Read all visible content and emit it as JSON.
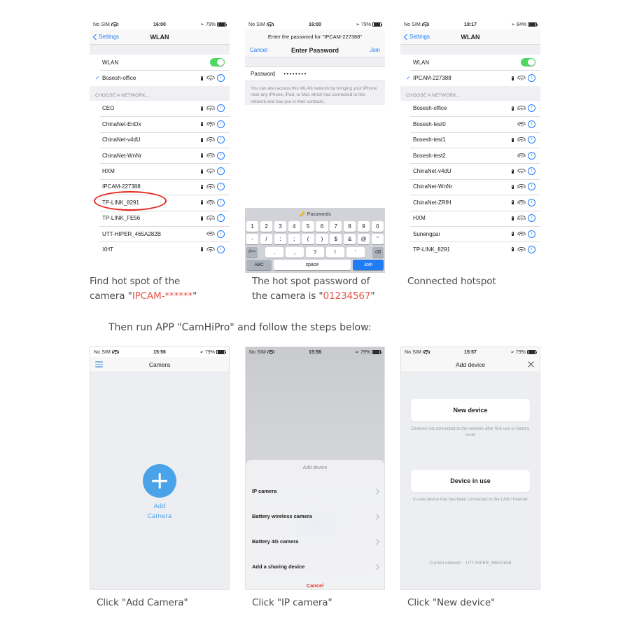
{
  "doc": {
    "middle_instruction": "Then run APP \"CamHiPro\" and follow the steps below:"
  },
  "panel1": {
    "status": {
      "carrier": "No SIM",
      "time": "16:00",
      "battery": "79%"
    },
    "nav": {
      "back": "Settings",
      "title": "WLAN"
    },
    "wlan_row_label": "WLAN",
    "connected": {
      "ssid": "Bosesh-office",
      "locked": true
    },
    "section_header": "CHOOSE A NETWORK...",
    "networks": [
      {
        "ssid": "CEO",
        "locked": true
      },
      {
        "ssid": "ChinaNet-EnDx",
        "locked": true
      },
      {
        "ssid": "ChinaNet-v4dU",
        "locked": true
      },
      {
        "ssid": "ChinaNet-WnNr",
        "locked": true
      },
      {
        "ssid": "HXM",
        "locked": true
      },
      {
        "ssid": "IPCAM-227388",
        "locked": true
      },
      {
        "ssid": "TP-LINK_8291",
        "locked": true
      },
      {
        "ssid": "TP-LINK_FE56",
        "locked": true
      },
      {
        "ssid": "UTT-HIPER_465A282B",
        "locked": false
      },
      {
        "ssid": "XHT",
        "locked": true
      }
    ],
    "caption_a": "Find hot spot of the",
    "caption_b": "camera \"",
    "caption_hl": "IPCAM-******",
    "caption_c": "\""
  },
  "panel2": {
    "status": {
      "carrier": "No SIM",
      "time": "16:00",
      "battery": "79%"
    },
    "prompt": "Enter the password for \"IPCAM-227388\"",
    "bar": {
      "cancel": "Cancel",
      "title": "Enter Password",
      "join": "Join"
    },
    "field": {
      "label": "Password",
      "value": "••••••••"
    },
    "note": "You can also access this WLAN network by bringing your iPhone near any iPhone, iPad, or Mac which has connected to this network and has you in their contacts.",
    "keyboard": {
      "suggestion": "Passwords",
      "row1": [
        "1",
        "2",
        "3",
        "4",
        "5",
        "6",
        "7",
        "8",
        "9",
        "0"
      ],
      "row2": [
        "-",
        "/",
        ":",
        ";",
        "(",
        ")",
        "$",
        "&",
        "@",
        "\""
      ],
      "row3_left": "#+=",
      "row3": [
        ".",
        ",",
        "?",
        "!",
        "'"
      ],
      "row3_right": "⌫",
      "abc": "ABC",
      "space": "space",
      "join": "Join"
    },
    "caption_a": "The hot spot password of",
    "caption_b": "the camera is \"",
    "caption_hl": "01234567",
    "caption_c": "\""
  },
  "panel3": {
    "status": {
      "carrier": "No SIM",
      "time": "19:17",
      "battery": "84%"
    },
    "nav": {
      "back": "Settings",
      "title": "WLAN"
    },
    "wlan_row_label": "WLAN",
    "connected": {
      "ssid": "IPCAM-227388",
      "locked": true
    },
    "section_header": "CHOOSE A NETWORK...",
    "networks": [
      {
        "ssid": "Bosesh-office",
        "locked": true
      },
      {
        "ssid": "Bosesh-test0",
        "locked": false
      },
      {
        "ssid": "Bosesh-test1",
        "locked": true
      },
      {
        "ssid": "Bosesh-test2",
        "locked": false
      },
      {
        "ssid": "ChinaNet-v4dU",
        "locked": true
      },
      {
        "ssid": "ChinaNet-WnNr",
        "locked": true
      },
      {
        "ssid": "ChinaNet-ZRfH",
        "locked": true
      },
      {
        "ssid": "HXM",
        "locked": true
      },
      {
        "ssid": "Sunengpai",
        "locked": true
      },
      {
        "ssid": "TP-LINK_8291",
        "locked": true
      }
    ],
    "caption": "Connected hotspot"
  },
  "panel4": {
    "status": {
      "carrier": "No SIM",
      "time": "15:56",
      "battery": "79%"
    },
    "nav": {
      "title": "Camera",
      "menu_icon": "hamburger-icon"
    },
    "add_camera_label": "Add Camera",
    "caption": "Click \"Add Camera\""
  },
  "panel5": {
    "status": {
      "carrier": "No SIM",
      "time": "15:56",
      "battery": "79%"
    },
    "sheet_title": "Add device",
    "items": [
      {
        "label": "IP camera"
      },
      {
        "label": "Battery wireless camera"
      },
      {
        "label": "Battery 4G camera"
      },
      {
        "label": "Add a sharing device"
      }
    ],
    "cancel": "Cancel",
    "caption": "Click \"IP camera\""
  },
  "panel6": {
    "status": {
      "carrier": "No SIM",
      "time": "15:57",
      "battery": "79%"
    },
    "nav": {
      "title": "Add device",
      "close_icon": "close-icon"
    },
    "new_device": {
      "title": "New device",
      "subtitle": "Devices not connected to the network after first use or factory reset"
    },
    "device_in_use": {
      "title": "Device in use",
      "subtitle": "In-use device that has been connected to the LAN / Internet"
    },
    "current_network": "Current network： UTT-HIPER_465A282B",
    "caption": "Click \"New device\""
  },
  "colors": {
    "ios_blue": "#1f7bf6",
    "toggle_green": "#4cd964",
    "accent_red": "#e8564a",
    "annotation_red": "#e8251b",
    "app_blue": "#4aa3e8"
  }
}
